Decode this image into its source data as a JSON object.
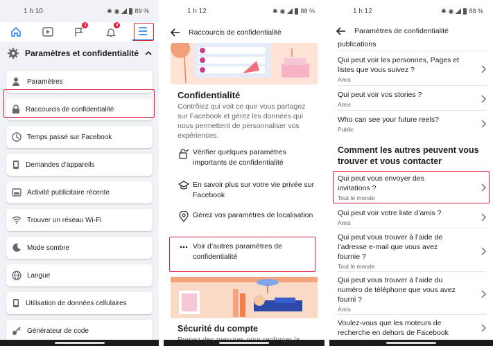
{
  "panel1": {
    "status": {
      "time": "1 h 10",
      "battery": "89 %"
    },
    "nav_badges": {
      "flag": "1",
      "bell": "4"
    },
    "section_title": "Paramètres et confidentialité",
    "items": [
      {
        "label": "Paramètres",
        "icon": "user-gear-icon"
      },
      {
        "label": "Raccourcis de confidentialité",
        "icon": "lock-icon"
      },
      {
        "label": "Temps passé sur Facebook",
        "icon": "clock-icon"
      },
      {
        "label": "Demandes d’appareils",
        "icon": "device-icon"
      },
      {
        "label": "Activité publicitaire récente",
        "icon": "ad-icon"
      },
      {
        "label": "Trouver un réseau Wi-Fi",
        "icon": "wifi-icon"
      },
      {
        "label": "Mode sombre",
        "icon": "moon-icon"
      },
      {
        "label": "Langue",
        "icon": "globe-icon"
      },
      {
        "label": "Utilisation de données cellulaires",
        "icon": "phone-icon"
      },
      {
        "label": "Générateur de code",
        "icon": "key-icon"
      }
    ]
  },
  "panel2": {
    "status": {
      "time": "1 h 12",
      "battery": "88 %"
    },
    "header_title": "Raccourcis de confidentialité",
    "section_title": "Confidentialité",
    "section_desc": "Contrôlez qui voit ce que vous partagez sur Facebook et gérez les données qui nous permettent de personnaliser vos expériences.",
    "items": [
      {
        "label": "Vérifier quelques paramètres importants de confidentialité",
        "icon": "lock-check-icon"
      },
      {
        "label": "En savoir plus sur votre vie privée sur Facebook",
        "icon": "graduation-cap-icon"
      },
      {
        "label": "Gérez vos paramètres de localisation",
        "icon": "location-pin-icon"
      },
      {
        "label": "Voir d’autres paramètres de confidentialité",
        "icon": "more-dots-icon"
      }
    ],
    "security_title": "Sécurité du compte",
    "security_desc": "Prenez des mesures pour renforcer la"
  },
  "panel3": {
    "status": {
      "time": "1 h 12",
      "battery": "88 %"
    },
    "header_title": "Paramètres de confidentialité",
    "top_partial": "publications",
    "rows_a": [
      {
        "q": "Qui peut voir les personnes, Pages et listes que vous suivez ?",
        "a": "Amis"
      },
      {
        "q": "Qui peut voir vos stories ?",
        "a": "Amis"
      },
      {
        "q": "Who can see your future reels?",
        "a": "Public"
      }
    ],
    "section_title": "Comment les autres peuvent vous trouver et vous contacter",
    "rows_b": [
      {
        "q": "Qui peut vous envoyer des invitations ?",
        "a": "Tout le monde"
      },
      {
        "q": "Qui peut voir votre liste d’amis ?",
        "a": "Amis"
      },
      {
        "q": "Qui peut vous trouver à l’aide de l’adresse e-mail que vous avez fournie ?",
        "a": "Tout le monde"
      },
      {
        "q": "Qui peut vous trouver à l’aide du numéro de téléphone que vous avez fourni ?",
        "a": "Amis"
      },
      {
        "q": "Voulez-vous que les moteurs de recherche en dehors de Facebook",
        "a": ""
      }
    ]
  },
  "colors": {
    "accent": "#1877f2",
    "highlight": "#e41e3f",
    "background": "#f0f2f5"
  }
}
